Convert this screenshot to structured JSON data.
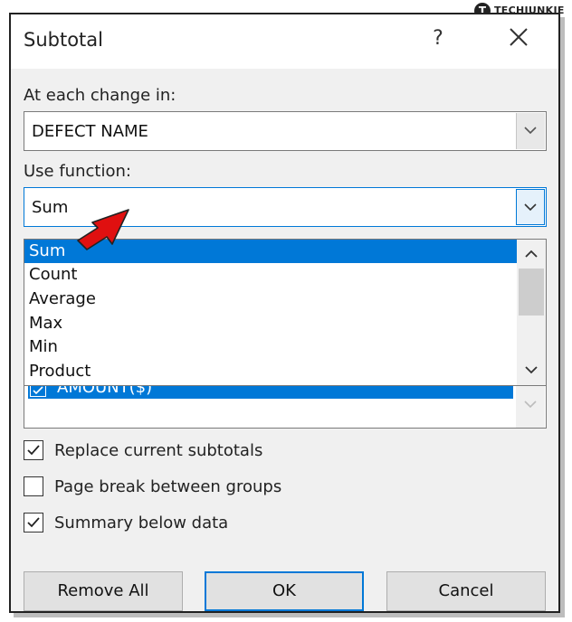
{
  "dialog": {
    "title": "Subtotal",
    "help_label": "?"
  },
  "change_in": {
    "label": "At each change in:",
    "value": "DEFECT NAME"
  },
  "function": {
    "label": "Use function:",
    "value": "Sum",
    "options": [
      "Sum",
      "Count",
      "Average",
      "Max",
      "Min",
      "Product"
    ],
    "selected_index": 0
  },
  "add_subtotal": {
    "items": [
      {
        "label": "AMOUNT($)",
        "checked": true
      }
    ]
  },
  "options": {
    "replace": {
      "label": "Replace current subtotals",
      "checked": true
    },
    "page_break": {
      "label": "Page break between groups",
      "checked": false
    },
    "summary": {
      "label": "Summary below data",
      "checked": true
    }
  },
  "buttons": {
    "remove_all": "Remove All",
    "ok": "OK",
    "cancel": "Cancel"
  },
  "watermark": {
    "logo_letter": "T",
    "brand": "TECHJUNKIE"
  },
  "colors": {
    "accent": "#0078d7",
    "annotation_arrow": "#e01010"
  }
}
